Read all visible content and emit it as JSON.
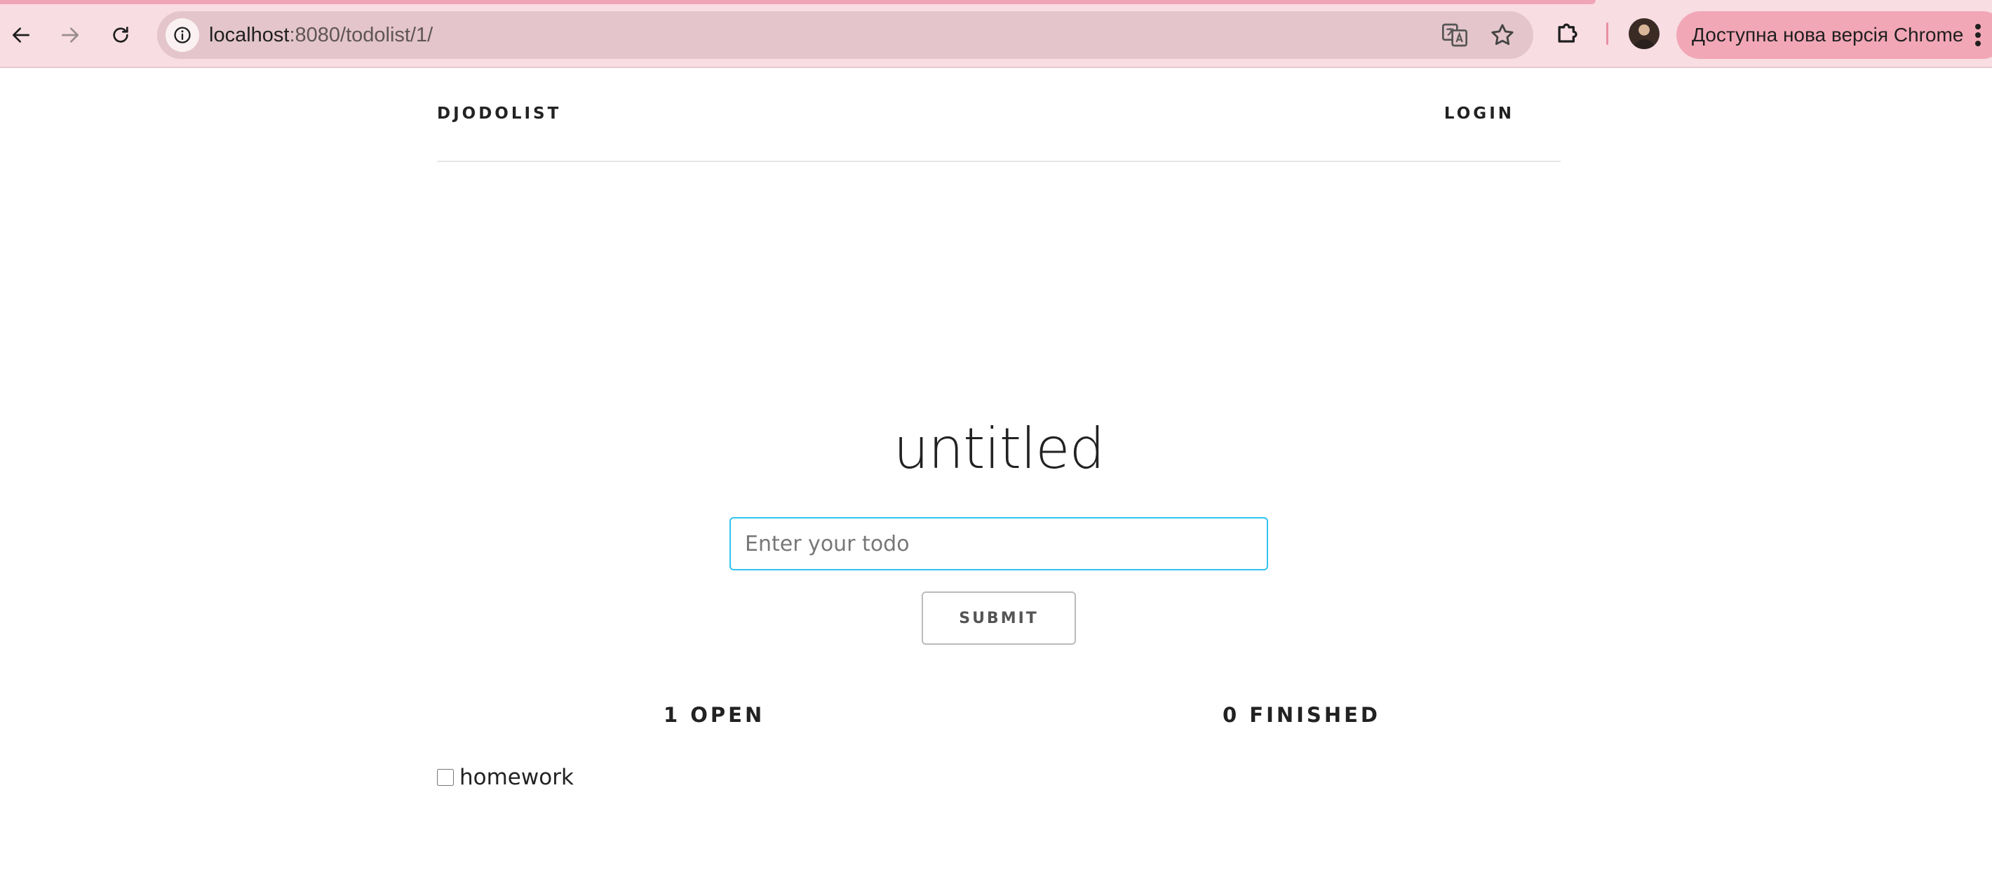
{
  "browser": {
    "url_host": "localhost",
    "url_rest": ":8080/todolist/1/",
    "update_label": "Доступна нова версія Chrome"
  },
  "header": {
    "brand": "DJODOLIST",
    "login": "LOGIN"
  },
  "main": {
    "title": "untitled",
    "todo_placeholder": "Enter your todo",
    "submit_label": "SUBMIT",
    "open_count": "1 OPEN",
    "finished_count": "0 FINISHED",
    "todos": [
      {
        "label": "homework",
        "done": false
      }
    ]
  },
  "colors": {
    "chrome_bg": "#f8dde3",
    "omnibox_bg": "#e3c5cb",
    "update_pill": "#f2a7b6",
    "input_focus_border": "#33c3f0"
  }
}
